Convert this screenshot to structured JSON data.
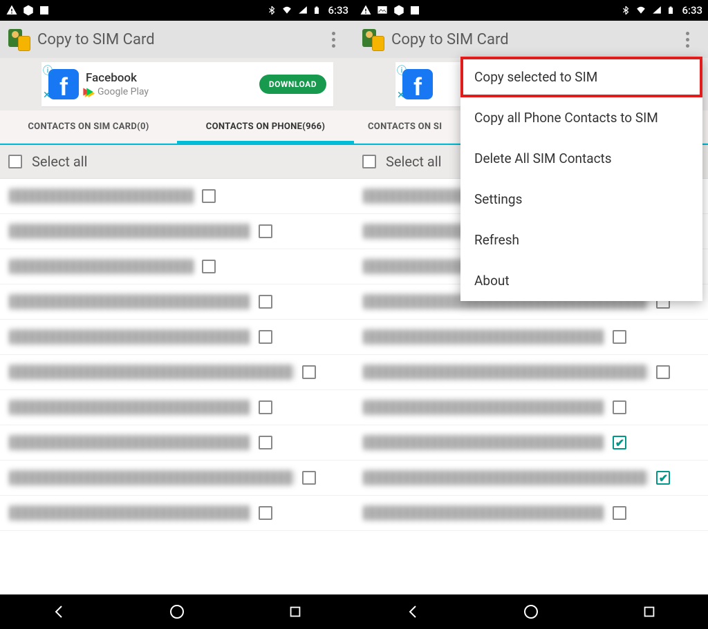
{
  "statusbar": {
    "time": "6:33"
  },
  "appbar": {
    "title": "Copy to SIM Card"
  },
  "ad": {
    "title": "Facebook",
    "store": "Google Play",
    "button": "DOWNLOAD"
  },
  "tabs": {
    "sim": "CONTACTS ON SIM CARD(0)",
    "phone": "CONTACTS ON PHONE(966)",
    "sim_partial": "CONTACTS ON SI"
  },
  "select_all": "Select all",
  "menu": {
    "copy_selected": "Copy selected to SIM",
    "copy_all": "Copy all Phone Contacts to SIM",
    "delete_all": "Delete All SIM Contacts",
    "settings": "Settings",
    "refresh": "Refresh",
    "about": "About"
  },
  "contacts_left": [
    {
      "checked": false,
      "w": "short"
    },
    {
      "checked": false,
      "w": "med"
    },
    {
      "checked": false,
      "w": "short"
    },
    {
      "checked": false,
      "w": "med"
    },
    {
      "checked": false,
      "w": "med"
    },
    {
      "checked": false,
      "w": "long"
    },
    {
      "checked": false,
      "w": "med"
    },
    {
      "checked": false,
      "w": "med"
    },
    {
      "checked": false,
      "w": "long"
    },
    {
      "checked": false,
      "w": "med"
    }
  ],
  "contacts_right": [
    {
      "checked": false,
      "w": "short"
    },
    {
      "checked": false,
      "w": "med"
    },
    {
      "checked": false,
      "w": "short"
    },
    {
      "checked": false,
      "w": "long"
    },
    {
      "checked": false,
      "w": "med"
    },
    {
      "checked": false,
      "w": "long"
    },
    {
      "checked": false,
      "w": "med"
    },
    {
      "checked": true,
      "w": "med"
    },
    {
      "checked": true,
      "w": "long"
    },
    {
      "checked": false,
      "w": "med"
    }
  ]
}
